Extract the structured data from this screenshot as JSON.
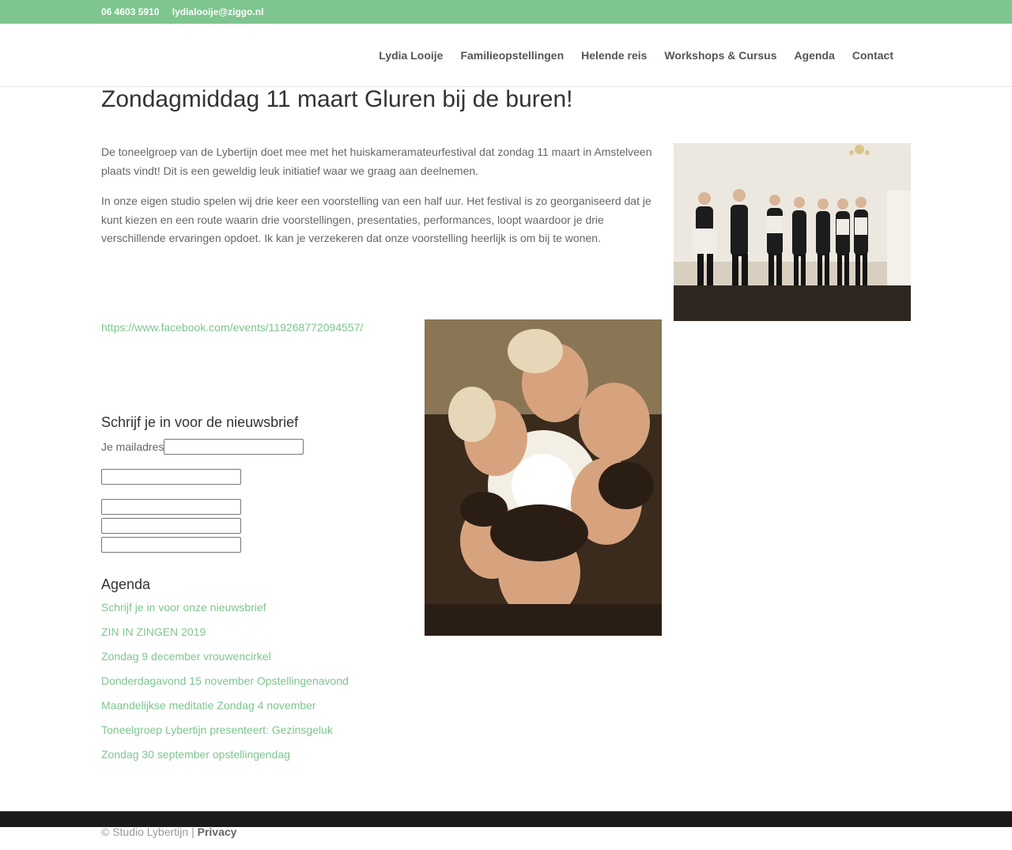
{
  "topbar": {
    "phone": "06 4603 5910",
    "email": "lydialooije@ziggo.nl"
  },
  "nav": {
    "items": [
      {
        "label": "Lydia Looije"
      },
      {
        "label": "Familieopstellingen"
      },
      {
        "label": "Helende reis"
      },
      {
        "label": "Workshops & Cursus"
      },
      {
        "label": "Agenda"
      },
      {
        "label": "Contact"
      }
    ]
  },
  "post": {
    "title": "Zondagmiddag 11 maart Gluren bij de buren!",
    "paragraph1": "De toneelgroep van de Lybertijn doet mee met het huiskameramateurfestival dat zondag 11 maart in Amstelveen plaats vindt! Dit is een geweldig leuk initiatief waar we graag aan deelnemen.",
    "paragraph2": "In onze eigen studio spelen wij drie keer een voorstelling van een half uur. Het festival is zo georganiseerd dat je kunt kiezen en een route waarin drie voorstellingen, presentaties, performances, loopt waardoor je drie verschillende ervaringen opdoet. Ik kan je verzekeren dat onze voorstelling heerlijk is om bij te wonen.",
    "facebook_link": "https://www.facebook.com/events/119268772094557/"
  },
  "newsletter": {
    "title": "Schrijf je in voor de nieuwsbrief",
    "email_label": "Je mailadres"
  },
  "agenda": {
    "title": "Agenda",
    "items": [
      {
        "label": "Schrijf je in voor onze nieuwsbrief"
      },
      {
        "label": "ZIN IN ZINGEN 2019"
      },
      {
        "label": "Zondag 9 december vrouwencirkel"
      },
      {
        "label": "Donderdagavond 15 november Opstellingenavond"
      },
      {
        "label": "Maandelijkse meditatie Zondag 4 november"
      },
      {
        "label": "Toneelgroep Lybertijn presenteert: Gezinsgeluk"
      },
      {
        "label": "Zondag 30 september opstellingendag"
      }
    ]
  },
  "footer": {
    "copyright": "© Studio Lybertijn | ",
    "privacy": "Privacy"
  },
  "colors": {
    "accent": "#7ec58f",
    "footer_bar": "#1a1a1a"
  }
}
